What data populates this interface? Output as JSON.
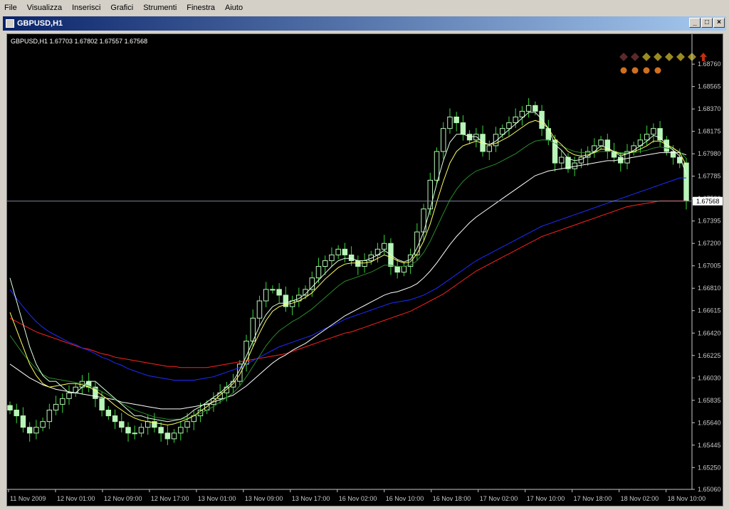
{
  "menu": [
    "File",
    "Visualizza",
    "Inserisci",
    "Grafici",
    "Strumenti",
    "Finestra",
    "Aiuto"
  ],
  "window": {
    "title": "GBPUSD,H1"
  },
  "header": {
    "text": "GBPUSD,H1  1.67703 1.67802 1.67557 1.67568"
  },
  "current_price": "1.67568",
  "colors": {
    "background": "#000000",
    "candle": "#b8f5b8",
    "wick": "#39d839",
    "ma_red": "#ff2020",
    "ma_blue": "#1c2cff",
    "ma_white": "#ffffff",
    "ma_green": "#2a8a2a",
    "ma_yellow": "#ffff60",
    "axis": "#c8c8c8"
  },
  "signals": {
    "row1": [
      {
        "icon": "diamond-icon",
        "color": "#5a2a2a"
      },
      {
        "icon": "diamond-icon",
        "color": "#5a2a2a"
      },
      {
        "icon": "diamond-icon",
        "color": "#9a8a20"
      },
      {
        "icon": "diamond-icon",
        "color": "#9a8a20"
      },
      {
        "icon": "diamond-icon",
        "color": "#9a8a20"
      },
      {
        "icon": "diamond-icon",
        "color": "#9a8a20"
      },
      {
        "icon": "diamond-icon",
        "color": "#9a8a20"
      },
      {
        "icon": "arrow-up-icon",
        "color": "#c03010"
      }
    ],
    "row2": [
      {
        "icon": "dot-icon",
        "color": "#d07020"
      },
      {
        "icon": "dot-icon",
        "color": "#d07020"
      },
      {
        "icon": "dot-icon",
        "color": "#d07020"
      },
      {
        "icon": "dot-icon",
        "color": "#d07020"
      }
    ]
  },
  "chart_data": {
    "type": "line",
    "y_ticks": [
      "1.68760",
      "1.68565",
      "1.68370",
      "1.68175",
      "1.67980",
      "1.67785",
      "1.67590",
      "1.67395",
      "1.67200",
      "1.67005",
      "1.66810",
      "1.66615",
      "1.66420",
      "1.66225",
      "1.66030",
      "1.65835",
      "1.65640",
      "1.65445",
      "1.65250",
      "1.65060"
    ],
    "ylim": [
      1.6506,
      1.6886
    ],
    "x_ticks": [
      "11 Nov 2009",
      "12 Nov 01:00",
      "12 Nov 09:00",
      "12 Nov 17:00",
      "13 Nov 01:00",
      "13 Nov 09:00",
      "13 Nov 17:00",
      "16 Nov 02:00",
      "16 Nov 10:00",
      "16 Nov 18:00",
      "17 Nov 02:00",
      "17 Nov 10:00",
      "17 Nov 18:00",
      "18 Nov 02:00",
      "18 Nov 10:00"
    ],
    "close_series": [
      1.6575,
      1.657,
      1.656,
      1.6555,
      1.656,
      1.6565,
      1.6575,
      1.658,
      1.6585,
      1.659,
      1.6595,
      1.66,
      1.6595,
      1.6585,
      1.6575,
      1.657,
      1.6565,
      1.656,
      1.6555,
      1.6555,
      1.656,
      1.6565,
      1.656,
      1.6555,
      1.655,
      1.6555,
      1.656,
      1.6565,
      1.657,
      1.6575,
      1.658,
      1.6585,
      1.659,
      1.6595,
      1.66,
      1.6615,
      1.6635,
      1.6655,
      1.667,
      1.668,
      1.668,
      1.6675,
      1.6665,
      1.667,
      1.6675,
      1.668,
      1.669,
      1.67,
      1.6705,
      1.671,
      1.6715,
      1.671,
      1.6705,
      1.67,
      1.6705,
      1.671,
      1.6715,
      1.672,
      1.67,
      1.6695,
      1.67,
      1.671,
      1.673,
      1.675,
      1.6775,
      1.68,
      1.682,
      1.683,
      1.6825,
      1.6815,
      1.681,
      1.6815,
      1.68,
      1.6805,
      1.6815,
      1.682,
      1.6825,
      1.683,
      1.6835,
      1.684,
      1.6835,
      1.682,
      1.681,
      1.679,
      1.6795,
      1.6785,
      1.679,
      1.6795,
      1.68,
      1.6805,
      1.681,
      1.68,
      1.6795,
      1.679,
      1.68,
      1.6805,
      1.681,
      1.6815,
      1.682,
      1.681,
      1.68,
      1.6795,
      1.679,
      1.6757
    ],
    "ma_fast": [
      1.669,
      1.667,
      1.665,
      1.663,
      1.6615,
      1.6605,
      1.66,
      1.66,
      1.6595,
      1.659,
      1.659,
      1.6595,
      1.66,
      1.66,
      1.6595,
      1.659,
      1.6585,
      1.658,
      1.6575,
      1.657,
      1.657,
      1.6568,
      1.6567,
      1.6566,
      1.6565,
      1.6566,
      1.6567,
      1.657,
      1.6575,
      1.6578,
      1.6582,
      1.6586,
      1.659,
      1.6595,
      1.66,
      1.661,
      1.6622,
      1.6635,
      1.6648,
      1.6658,
      1.6665,
      1.6668,
      1.6668,
      1.667,
      1.6672,
      1.6676,
      1.6682,
      1.6688,
      1.6694,
      1.67,
      1.6705,
      1.6707,
      1.6707,
      1.6705,
      1.6705,
      1.6707,
      1.671,
      1.6714,
      1.671,
      1.6706,
      1.6704,
      1.6706,
      1.6716,
      1.673,
      1.675,
      1.6772,
      1.6792,
      1.6808,
      1.6815,
      1.6815,
      1.6813,
      1.6813,
      1.6808,
      1.6806,
      1.6809,
      1.6814,
      1.6819,
      1.6824,
      1.6829,
      1.6834,
      1.6834,
      1.6828,
      1.682,
      1.6806,
      1.6801,
      1.6794,
      1.6792,
      1.6793,
      1.6796,
      1.68,
      1.6805,
      1.6803,
      1.68,
      1.6796,
      1.6798,
      1.6801,
      1.6805,
      1.6809,
      1.6814,
      1.6812,
      1.6806,
      1.6801,
      1.6796,
      1.678
    ],
    "ma_yellow": [
      1.666,
      1.6645,
      1.663,
      1.6615,
      1.6605,
      1.6598,
      1.6595,
      1.6596,
      1.6597,
      1.6598,
      1.6598,
      1.6597,
      1.6595,
      1.6592,
      1.6588,
      1.6584,
      1.6579,
      1.6575,
      1.6571,
      1.6568,
      1.6566,
      1.6565,
      1.6564,
      1.6563,
      1.6562,
      1.6563,
      1.6565,
      1.6567,
      1.657,
      1.6574,
      1.6578,
      1.6583,
      1.6588,
      1.6593,
      1.6598,
      1.6606,
      1.6617,
      1.663,
      1.6642,
      1.6653,
      1.6661,
      1.6665,
      1.6667,
      1.6668,
      1.667,
      1.6673,
      1.6677,
      1.6683,
      1.6689,
      1.6694,
      1.6699,
      1.6702,
      1.6703,
      1.6703,
      1.6703,
      1.6704,
      1.6707,
      1.671,
      1.6708,
      1.6705,
      1.6703,
      1.6704,
      1.6711,
      1.6722,
      1.6737,
      1.6756,
      1.6774,
      1.679,
      1.68,
      1.6805,
      1.6807,
      1.6809,
      1.6807,
      1.6806,
      1.6807,
      1.681,
      1.6813,
      1.6817,
      1.6821,
      1.6825,
      1.6827,
      1.6825,
      1.682,
      1.6811,
      1.6806,
      1.68,
      1.6797,
      1.6796,
      1.6797,
      1.6799,
      1.6802,
      1.6802,
      1.68,
      1.6798,
      1.6798,
      1.68,
      1.6802,
      1.6805,
      1.6809,
      1.6809,
      1.6806,
      1.6803,
      1.6799,
      1.6788
    ],
    "ma_green": [
      1.664,
      1.6632,
      1.6624,
      1.6617,
      1.6611,
      1.6606,
      1.6603,
      1.6602,
      1.6601,
      1.66,
      1.6599,
      1.6598,
      1.6596,
      1.6594,
      1.6591,
      1.6588,
      1.6584,
      1.6581,
      1.6578,
      1.6575,
      1.6573,
      1.6571,
      1.6569,
      1.6568,
      1.6567,
      1.6567,
      1.6567,
      1.6568,
      1.657,
      1.6572,
      1.6575,
      1.6578,
      1.6582,
      1.6586,
      1.659,
      1.6596,
      1.6604,
      1.6613,
      1.6622,
      1.6631,
      1.6638,
      1.6644,
      1.6648,
      1.6652,
      1.6655,
      1.6659,
      1.6663,
      1.6668,
      1.6673,
      1.6678,
      1.6683,
      1.6687,
      1.6689,
      1.6691,
      1.6693,
      1.6695,
      1.6698,
      1.6701,
      1.6701,
      1.67,
      1.67,
      1.6701,
      1.6705,
      1.6712,
      1.6722,
      1.6734,
      1.6746,
      1.6758,
      1.6767,
      1.6774,
      1.6779,
      1.6783,
      1.6785,
      1.6787,
      1.6789,
      1.6792,
      1.6795,
      1.6798,
      1.6802,
      1.6806,
      1.6809,
      1.681,
      1.681,
      1.6807,
      1.6805,
      1.6802,
      1.68,
      1.6799,
      1.6799,
      1.6799,
      1.68,
      1.68,
      1.68,
      1.6799,
      1.6799,
      1.6799,
      1.68,
      1.6801,
      1.6803,
      1.6804,
      1.6803,
      1.6802,
      1.68,
      1.6794
    ],
    "ma_white": [
      1.6615,
      1.6611,
      1.6607,
      1.6603,
      1.66,
      1.6597,
      1.6595,
      1.6593,
      1.6592,
      1.6591,
      1.659,
      1.6589,
      1.6588,
      1.6587,
      1.6586,
      1.6585,
      1.6584,
      1.6582,
      1.6581,
      1.658,
      1.6579,
      1.6578,
      1.6577,
      1.6576,
      1.6576,
      1.6576,
      1.6576,
      1.6577,
      1.6578,
      1.6579,
      1.658,
      1.6582,
      1.6584,
      1.6586,
      1.6588,
      1.6592,
      1.6596,
      1.6601,
      1.6606,
      1.6611,
      1.6616,
      1.662,
      1.6623,
      1.6627,
      1.663,
      1.6633,
      1.6637,
      1.6641,
      1.6645,
      1.6649,
      1.6653,
      1.6657,
      1.666,
      1.6663,
      1.6666,
      1.6669,
      1.6672,
      1.6675,
      1.6677,
      1.6678,
      1.668,
      1.6682,
      1.6685,
      1.669,
      1.6696,
      1.6703,
      1.6711,
      1.6719,
      1.6726,
      1.6732,
      1.6738,
      1.6743,
      1.6747,
      1.6751,
      1.6755,
      1.6759,
      1.6763,
      1.6767,
      1.6771,
      1.6775,
      1.6779,
      1.6781,
      1.6783,
      1.6784,
      1.6785,
      1.6786,
      1.6787,
      1.6788,
      1.6789,
      1.679,
      1.6791,
      1.6792,
      1.6792,
      1.6793,
      1.6794,
      1.6795,
      1.6796,
      1.6797,
      1.6798,
      1.6799,
      1.6799,
      1.6799,
      1.6799,
      1.6797
    ],
    "ma_blue": [
      1.668,
      1.6672,
      1.6665,
      1.6658,
      1.6652,
      1.6647,
      1.6643,
      1.664,
      1.6637,
      1.6634,
      1.6632,
      1.6629,
      1.6627,
      1.6624,
      1.6621,
      1.6619,
      1.6616,
      1.6614,
      1.6611,
      1.6609,
      1.6607,
      1.6605,
      1.6604,
      1.6603,
      1.6602,
      1.6601,
      1.6601,
      1.6601,
      1.6601,
      1.6602,
      1.6603,
      1.6604,
      1.6606,
      1.6608,
      1.661,
      1.6612,
      1.6615,
      1.6618,
      1.6621,
      1.6624,
      1.6627,
      1.663,
      1.6632,
      1.6634,
      1.6636,
      1.6638,
      1.664,
      1.6643,
      1.6646,
      1.6648,
      1.6651,
      1.6654,
      1.6656,
      1.6658,
      1.666,
      1.6662,
      1.6664,
      1.6666,
      1.6668,
      1.6669,
      1.667,
      1.6671,
      1.6673,
      1.6675,
      1.6678,
      1.6681,
      1.6685,
      1.6689,
      1.6693,
      1.6697,
      1.6701,
      1.6705,
      1.6708,
      1.6711,
      1.6714,
      1.6717,
      1.672,
      1.6723,
      1.6726,
      1.6729,
      1.6732,
      1.6735,
      1.6737,
      1.6739,
      1.6741,
      1.6743,
      1.6745,
      1.6747,
      1.6749,
      1.6751,
      1.6753,
      1.6755,
      1.6757,
      1.6759,
      1.6761,
      1.6763,
      1.6765,
      1.6767,
      1.6769,
      1.6771,
      1.6773,
      1.6775,
      1.6777,
      1.6777
    ],
    "ma_red": [
      1.6655,
      1.6652,
      1.6649,
      1.6646,
      1.6643,
      1.6641,
      1.6639,
      1.6637,
      1.6635,
      1.6633,
      1.6631,
      1.6629,
      1.6628,
      1.6626,
      1.6624,
      1.6623,
      1.6621,
      1.662,
      1.6619,
      1.6618,
      1.6617,
      1.6616,
      1.6615,
      1.6614,
      1.6613,
      1.6613,
      1.6612,
      1.6612,
      1.6612,
      1.6612,
      1.6612,
      1.6613,
      1.6614,
      1.6615,
      1.6616,
      1.6617,
      1.6618,
      1.6619,
      1.662,
      1.6621,
      1.6622,
      1.6623,
      1.6624,
      1.6626,
      1.6628,
      1.663,
      1.6632,
      1.6634,
      1.6636,
      1.6638,
      1.664,
      1.6642,
      1.6643,
      1.6645,
      1.6647,
      1.6649,
      1.6651,
      1.6653,
      1.6655,
      1.6657,
      1.6659,
      1.6661,
      1.6664,
      1.6667,
      1.667,
      1.6673,
      1.6676,
      1.668,
      1.6684,
      1.6688,
      1.6692,
      1.6696,
      1.6699,
      1.6702,
      1.6705,
      1.6708,
      1.6711,
      1.6714,
      1.6717,
      1.672,
      1.6723,
      1.6726,
      1.6728,
      1.673,
      1.6732,
      1.6734,
      1.6736,
      1.6738,
      1.674,
      1.6742,
      1.6744,
      1.6746,
      1.6748,
      1.675,
      1.6752,
      1.6753,
      1.6754,
      1.6755,
      1.6756,
      1.6757,
      1.6757,
      1.6757,
      1.6757,
      1.6757
    ]
  }
}
